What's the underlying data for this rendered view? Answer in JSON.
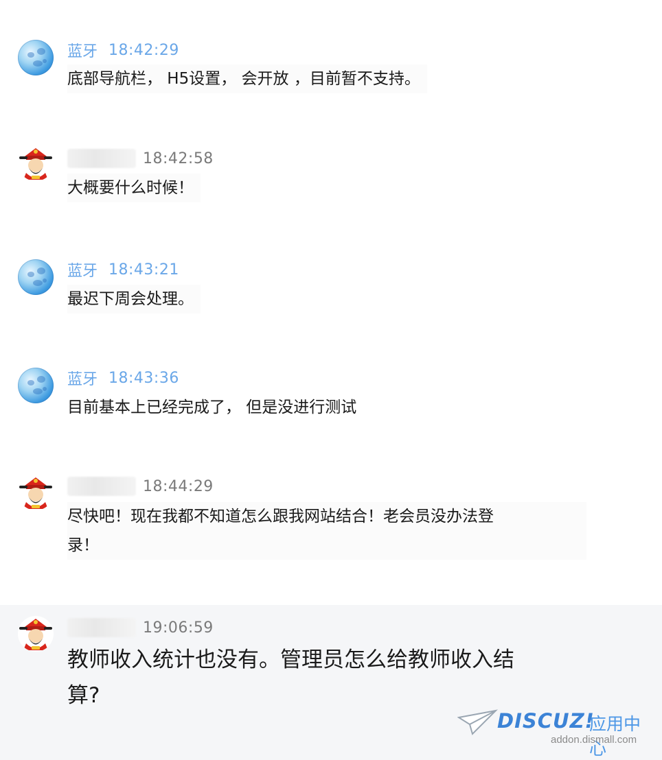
{
  "messages": [
    {
      "sender": "蓝牙",
      "time": "18:42:29",
      "text": "底部导航栏， H5设置， 会开放 ，目前暂不支持。"
    },
    {
      "sender": "",
      "time": "18:42:58",
      "text": "大概要什么时候！"
    },
    {
      "sender": "蓝牙",
      "time": "18:43:21",
      "text": "最迟下周会处理。"
    },
    {
      "sender": "蓝牙",
      "time": "18:43:36",
      "text": "目前基本上已经完成了， 但是没进行测试"
    },
    {
      "sender": "",
      "time": "18:44:29",
      "text_line1": "尽快吧！现在我都不知道怎么跟我网站结合！老会员没办法登",
      "text_line2": "录！"
    },
    {
      "sender": "",
      "time": "19:06:59",
      "text_line1": "教师收入统计也没有。管理员怎么给教师收入结",
      "text_line2": "算?"
    }
  ],
  "watermark": {
    "brand": "DISCUZ!",
    "suffix": "应用中心",
    "domain": "addon.dismall.com"
  },
  "colors": {
    "name_blue": "#6aa7e8",
    "time_gray": "#7a7a7a",
    "text": "#1a1a1a",
    "highlight_bg": "#f5f6f8"
  }
}
